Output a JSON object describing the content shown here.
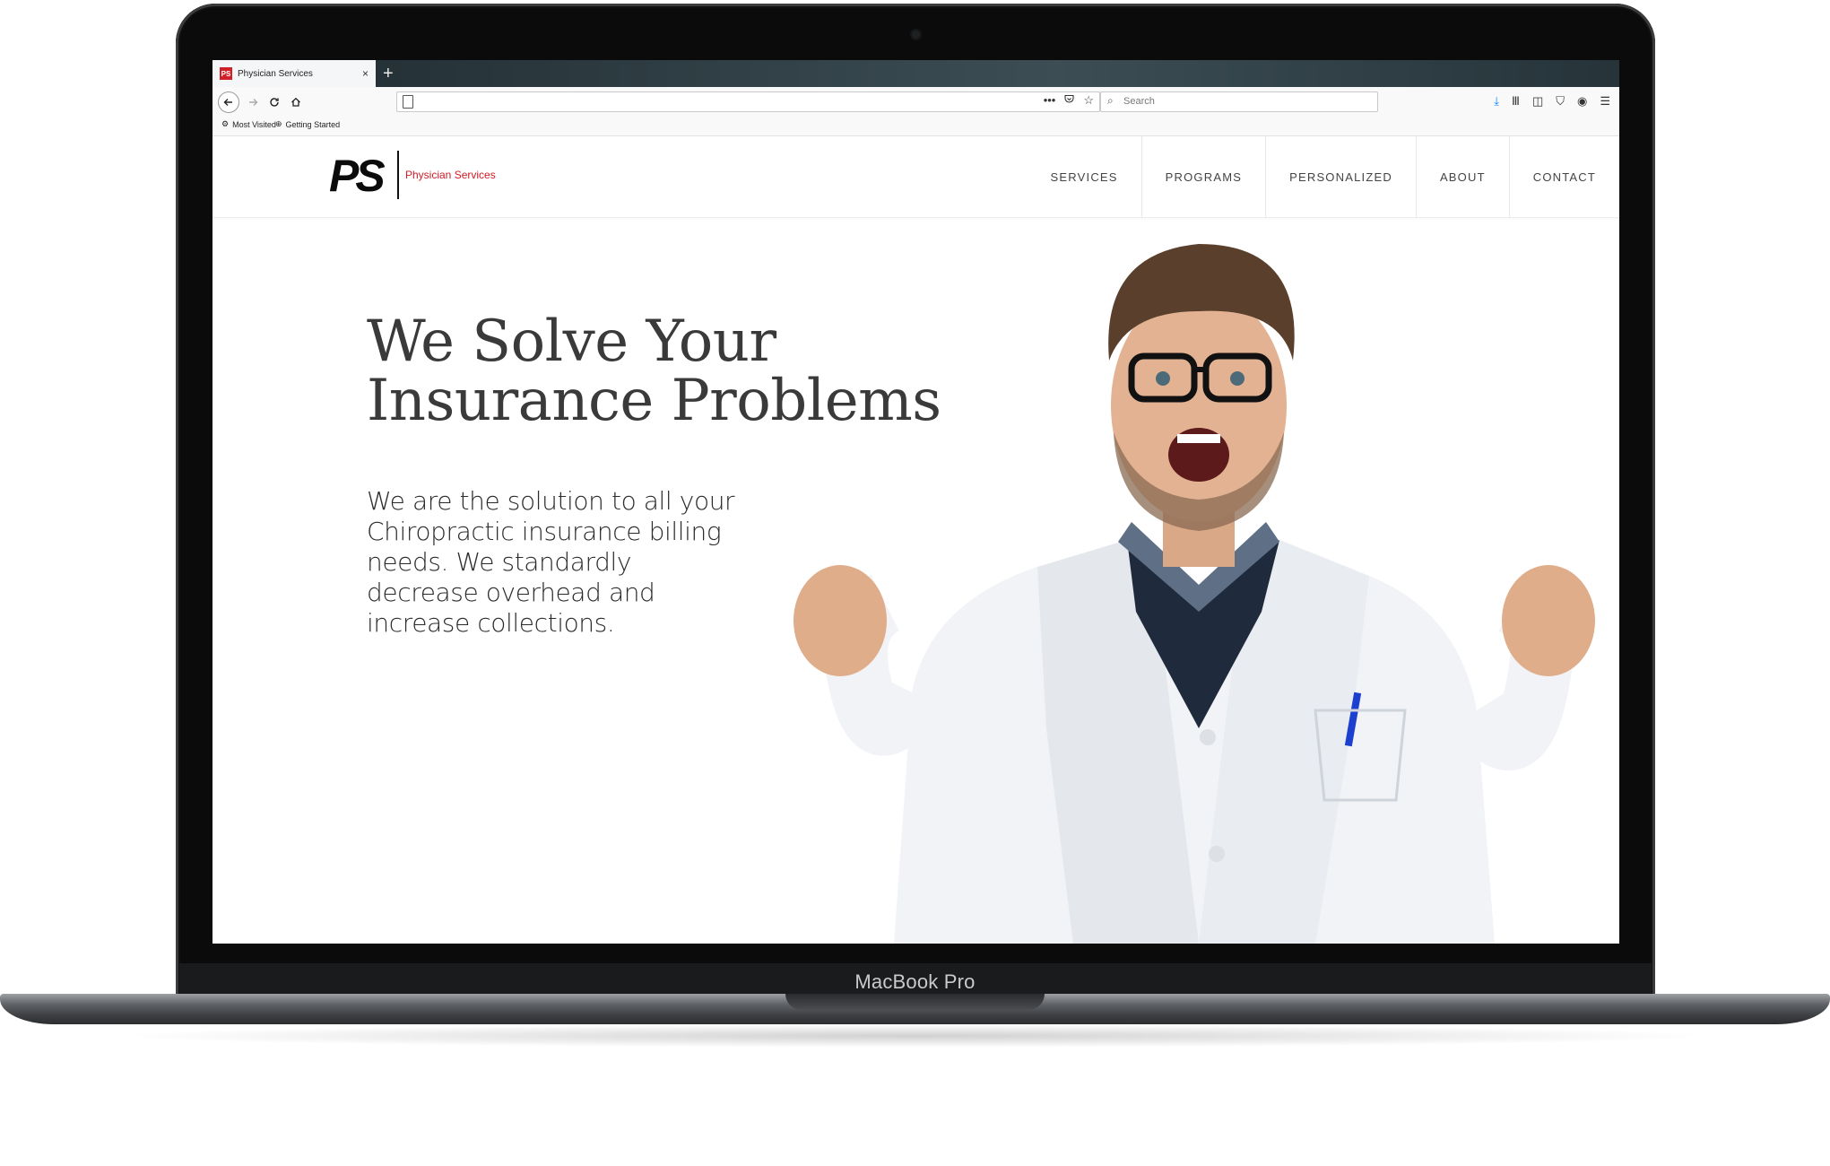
{
  "device": {
    "brand_label": "MacBook Pro"
  },
  "browser": {
    "tab_title": "Physician Services",
    "tab_favicon": "PS",
    "tab_close": "×",
    "new_tab": "+",
    "search_placeholder": "Search",
    "url_actions": [
      "•••",
      "pocket-icon",
      "star-icon"
    ],
    "toolbar_icons": [
      "download-icon",
      "library-icon",
      "sidebar-icon",
      "shield-icon",
      "account-icon",
      "menu-icon"
    ],
    "bookmarks": [
      {
        "label": "Most Visited",
        "icon": "gear-icon"
      },
      {
        "label": "Getting Started",
        "icon": "globe-icon"
      }
    ]
  },
  "site": {
    "logo_mark": "PS",
    "logo_text": "Physician Services",
    "nav": [
      "SERVICES",
      "PROGRAMS",
      "PERSONALIZED",
      "ABOUT",
      "CONTACT"
    ],
    "headline_line1": "We Solve Your",
    "headline_line2": "Insurance Problems",
    "subtext": "We are the solution to all your Chiropractic insurance billing needs. We standardly decrease overhead and increase collections."
  },
  "colors": {
    "accent": "#d01c24",
    "text": "#3a3a3a"
  }
}
